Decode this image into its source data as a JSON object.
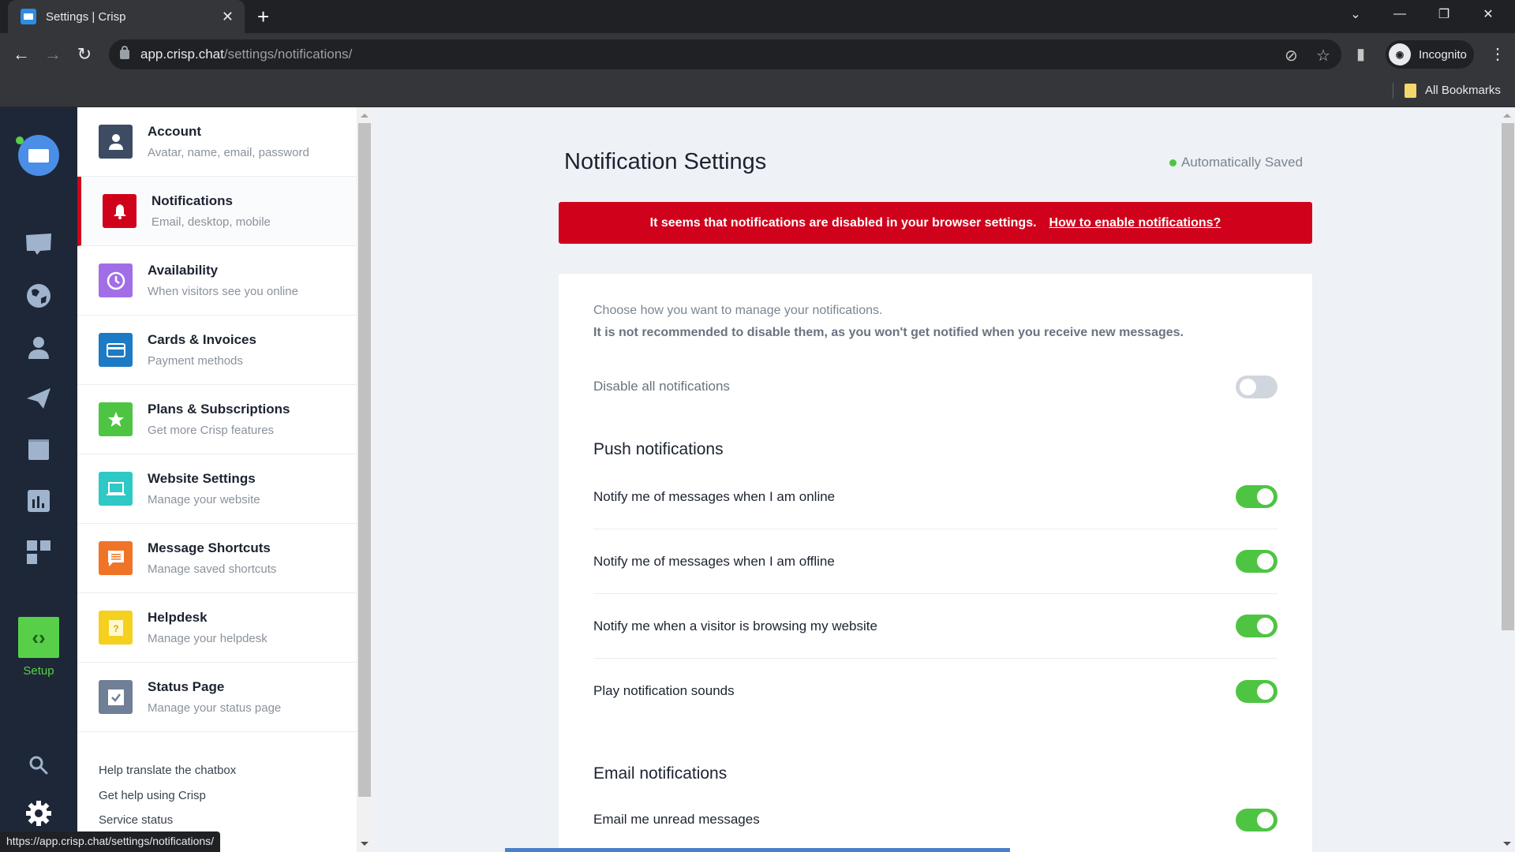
{
  "browser": {
    "tab_title": "Settings | Crisp",
    "url_host": "app.crisp.chat",
    "url_path": "/settings/notifications/",
    "profile_label": "Incognito",
    "bookmarks_label": "All Bookmarks",
    "status_url": "https://app.crisp.chat/settings/notifications/"
  },
  "rail": {
    "items": [
      {
        "icon": "inbox-icon"
      },
      {
        "icon": "globe-icon"
      },
      {
        "icon": "contacts-icon"
      },
      {
        "icon": "campaigns-icon"
      },
      {
        "icon": "helpdesk-book-icon"
      },
      {
        "icon": "analytics-icon"
      },
      {
        "icon": "plugins-icon"
      }
    ],
    "setup_label": "Setup"
  },
  "sidebar": {
    "items": [
      {
        "title": "Account",
        "subtitle": "Avatar, name, email, password",
        "icon": "user-icon",
        "color": "#3d4b63"
      },
      {
        "title": "Notifications",
        "subtitle": "Email, desktop, mobile",
        "icon": "bell-icon",
        "color": "#d0021b",
        "active": true
      },
      {
        "title": "Availability",
        "subtitle": "When visitors see you online",
        "icon": "clock-icon",
        "color": "#a16ee8"
      },
      {
        "title": "Cards & Invoices",
        "subtitle": "Payment methods",
        "icon": "credit-card-icon",
        "color": "#1d7ac4"
      },
      {
        "title": "Plans & Subscriptions",
        "subtitle": "Get more Crisp features",
        "icon": "star-icon",
        "color": "#4ec542"
      },
      {
        "title": "Website Settings",
        "subtitle": "Manage your website",
        "icon": "laptop-icon",
        "color": "#2ec8c6"
      },
      {
        "title": "Message Shortcuts",
        "subtitle": "Manage saved shortcuts",
        "icon": "message-icon",
        "color": "#f07428"
      },
      {
        "title": "Helpdesk",
        "subtitle": "Manage your helpdesk",
        "icon": "helpdesk-icon",
        "color": "#f5d01f"
      },
      {
        "title": "Status Page",
        "subtitle": "Manage your status page",
        "icon": "check-icon",
        "color": "#6f7f96"
      }
    ],
    "links": [
      "Help translate the chatbox",
      "Get help using Crisp",
      "Service status"
    ]
  },
  "main": {
    "title": "Notification Settings",
    "saved_status": "Automatically Saved",
    "alert_text": "It seems that notifications are disabled in your browser settings.",
    "alert_link": "How to enable notifications?",
    "intro_line1": "Choose how you want to manage your notifications.",
    "intro_line2": "It is not recommended to disable them, as you won't get notified when you receive new messages.",
    "disable_all": {
      "label": "Disable all notifications",
      "on": false
    },
    "push_heading": "Push notifications",
    "push_items": [
      {
        "label": "Notify me of messages when I am online",
        "on": true
      },
      {
        "label": "Notify me of messages when I am offline",
        "on": true
      },
      {
        "label": "Notify me when a visitor is browsing my website",
        "on": true
      },
      {
        "label": "Play notification sounds",
        "on": true
      }
    ],
    "email_heading": "Email notifications",
    "email_items": [
      {
        "label": "Email me unread messages",
        "on": true
      }
    ]
  }
}
